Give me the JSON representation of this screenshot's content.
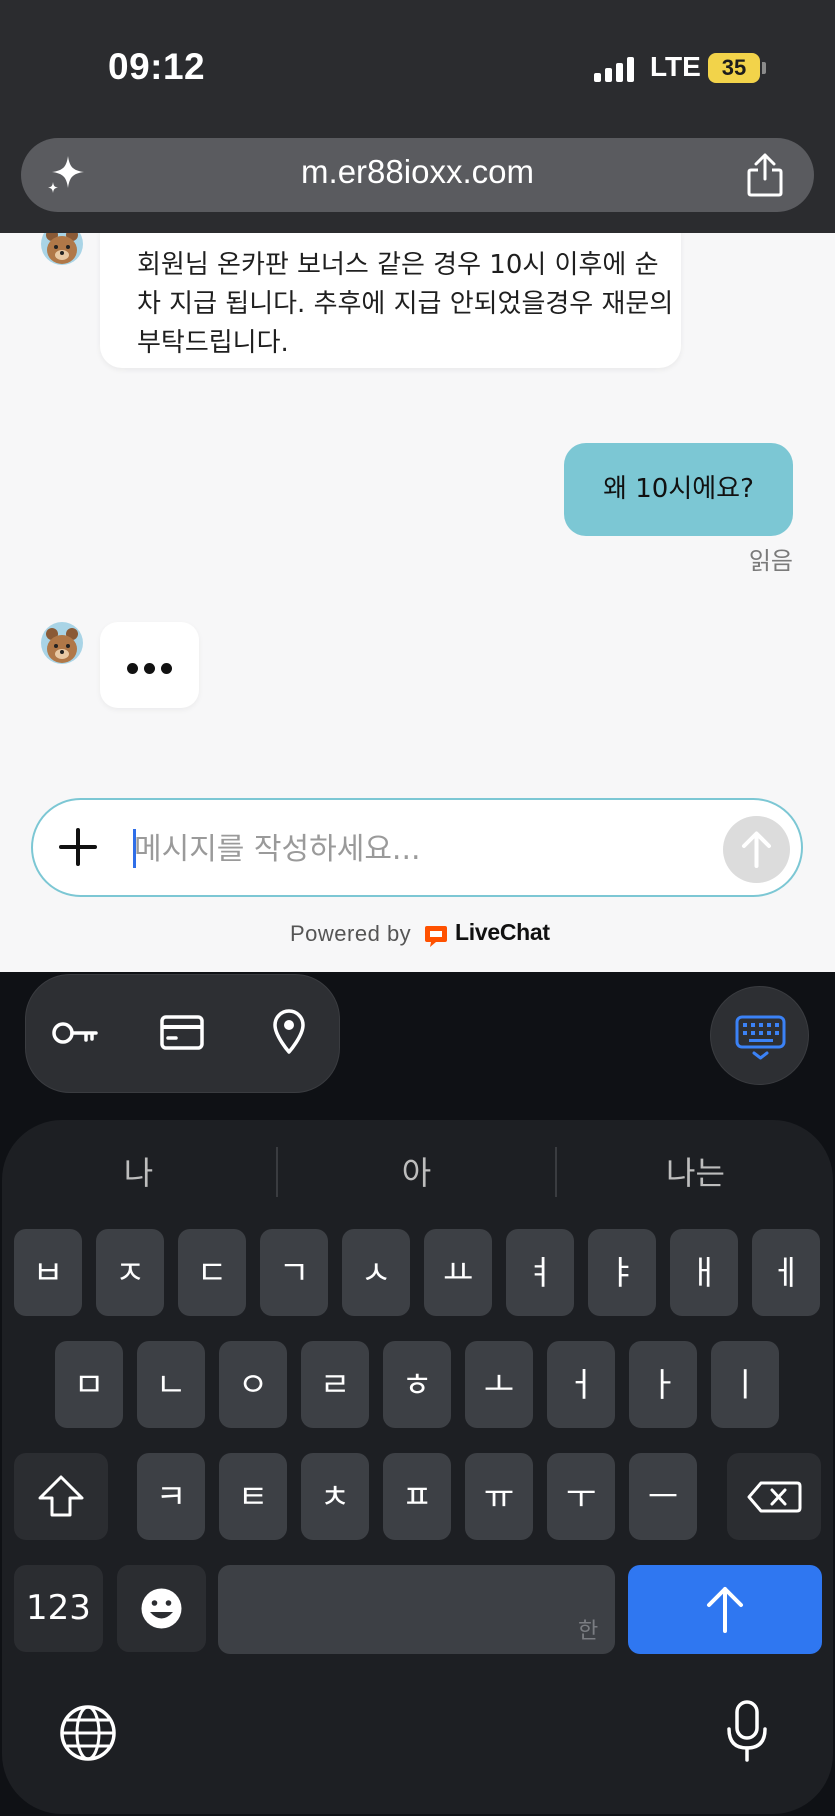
{
  "status_bar": {
    "time": "09:12",
    "network": "LTE",
    "battery": "35",
    "icons": [
      "signal-bars-icon",
      "battery-icon"
    ]
  },
  "browser": {
    "url": "m.er88ioxx.com",
    "icons": [
      "sparkle-icon",
      "share-icon"
    ]
  },
  "chat": {
    "agent_message": "회원님 온카판 보너스 같은 경우 10시 이후에 순차 지급 됩니다. 추후에 지급 안되었을경우 재문의 부탁드립니다.",
    "user_message": "왜 10시에요?",
    "read_status": "읽음",
    "composer_placeholder": "메시지를 작성하세요...",
    "powered_by": "Powered by",
    "brand": "LiveChat",
    "colors": {
      "user_bubble": "#7cc7d4",
      "livechat_orange": "#ff5100"
    }
  },
  "keyboard": {
    "tools": [
      "key-icon",
      "card-icon",
      "location-pin-icon"
    ],
    "suggestions": [
      "나",
      "아",
      "나는"
    ],
    "row1": [
      "ㅂ",
      "ㅈ",
      "ㄷ",
      "ㄱ",
      "ㅅ",
      "ㅛ",
      "ㅕ",
      "ㅑ",
      "ㅐ",
      "ㅔ"
    ],
    "row2": [
      "ㅁ",
      "ㄴ",
      "ㅇ",
      "ㄹ",
      "ㅎ",
      "ㅗ",
      "ㅓ",
      "ㅏ",
      "ㅣ"
    ],
    "row3": [
      "ㅋ",
      "ㅌ",
      "ㅊ",
      "ㅍ",
      "ㅠ",
      "ㅜ",
      "ㅡ"
    ],
    "numbers_key": "123",
    "space_hint": "한",
    "accent": "#2f77f1"
  }
}
